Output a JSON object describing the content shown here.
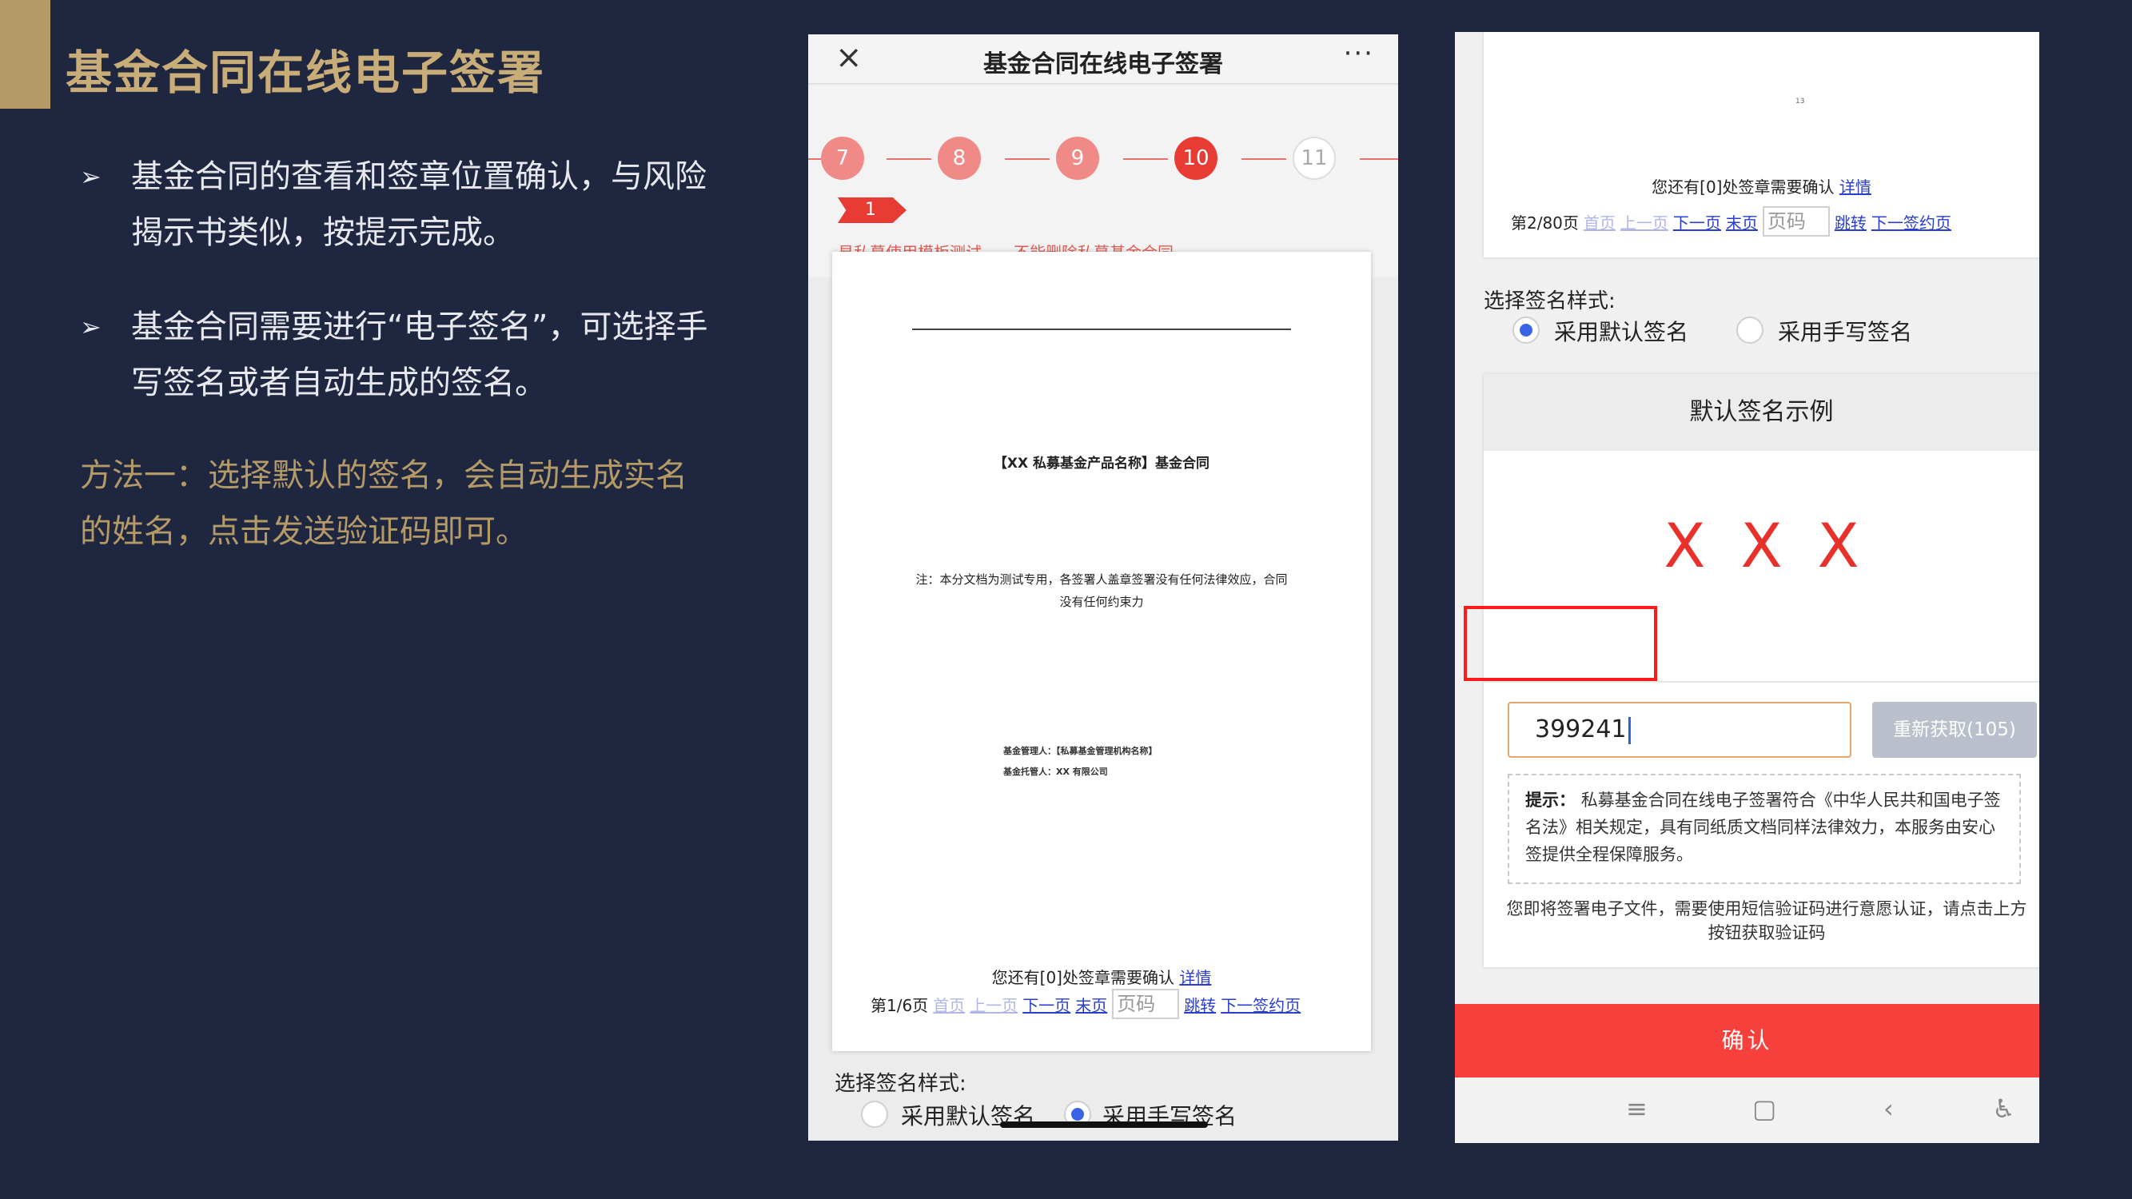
{
  "slide": {
    "title": "基金合同在线电子签署",
    "bullet_marker": "➢",
    "bullets": [
      "基金合同的查看和签章位置确认，与风险揭示书类似，按提示完成。",
      "基金合同需要进行“电子签名”，可选择手写签名或者自动生成的签名。"
    ],
    "method": "方法一：选择默认的签名，会自动生成实名的姓名，点击发送验证码即可。"
  },
  "phone1": {
    "close_icon": "×",
    "title": "基金合同在线电子签署",
    "more_icon": "···",
    "steps": [
      "7",
      "8",
      "9",
      "10",
      "11"
    ],
    "active_step": "10",
    "flag": "1",
    "step_note": "易私募使用模板测试——不能删除私募基金合同",
    "doc": {
      "title": "【XX 私募基金产品名称】基金合同",
      "note": "注：本分文档为测试专用，各签署人盖章签署没有任何法律效应，合同没有任何约束力",
      "manager": "基金管理人：【私募基金管理机构名称】",
      "custodian": "基金托管人：XX 有限公司",
      "remain_text": "您还有[0]处签章需要确认",
      "remain_link": "详情"
    },
    "pager": {
      "current": "第1/6页",
      "first": "首页",
      "prev": "上一页",
      "next": "下一页",
      "last": "末页",
      "page_placeholder": "页码",
      "jump": "跳转",
      "next_sign": "下一签约页"
    },
    "sig_style_label": "选择签名样式:",
    "radio_default": "采用默认签名",
    "radio_handwrite": "采用手写签名"
  },
  "phone2": {
    "doc_dot": "13",
    "remain_text": "您还有[0]处签章需要确认",
    "remain_link": "详情",
    "pager": {
      "current": "第2/80页",
      "first": "首页",
      "prev": "上一页",
      "next": "下一页",
      "last": "末页",
      "page_placeholder": "页码",
      "jump": "跳转",
      "next_sign": "下一签约页"
    },
    "sig_style_label": "选择签名样式:",
    "radio_default": "采用默认签名",
    "radio_handwrite": "采用手写签名",
    "sample_title": "默认签名示例",
    "sample_sig": "XXX",
    "code_value": "399241",
    "resend_label": "重新获取(105)",
    "tip_label": "提示：",
    "tip_text": "私募基金合同在线电子签署符合《中华人民共和国电子签名法》相关规定，具有同纸质文档同样法律效力，本服务由安心签提供全程保障服务。",
    "desc": "您即将签署电子文件，需要使用短信验证码进行意愿认证，请点击上方按钮获取验证码",
    "confirm_label": "确认",
    "nav": {
      "menu_icon": "≡",
      "home_icon": "▢",
      "back_icon": "‹",
      "accessibility_icon": "♿"
    }
  },
  "colors": {
    "background": "#1f2640",
    "gold": "#b39a67",
    "accent_red": "#e83b34",
    "confirm_red": "#f5403b",
    "link_blue": "#2b3fcf"
  }
}
